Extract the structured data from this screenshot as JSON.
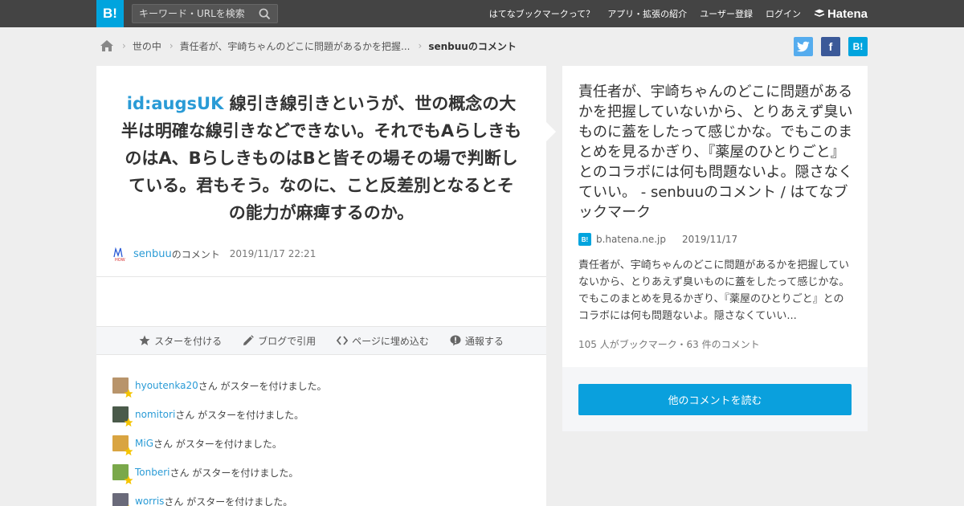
{
  "header": {
    "logo": "B!",
    "search_placeholder": "キーワード・URLを検索",
    "nav": [
      "はてなブックマークって？",
      "アプリ・拡張の紹介",
      "ユーザー登録",
      "ログイン"
    ],
    "brand": "Hatena"
  },
  "breadcrumb": {
    "items": [
      "世の中",
      "責任者が、宇崎ちゃんのどこに問題があるかを把握..."
    ],
    "current": "senbuuのコメント"
  },
  "share": {
    "twitter": "t",
    "facebook": "f",
    "hatena": "B!"
  },
  "comment": {
    "user_id": "id:augsUK",
    "text": " 線引き線引きというが、世の概念の大半は明確な線引きなどできない。それでもAらしきものはA、BらしきものはBと皆その場その場で判断している。君もそう。なのに、こと反差別となるとその能力が麻痺するのか。",
    "author": "senbuu",
    "author_suffix": "のコメント",
    "datetime": "2019/11/17 22:21"
  },
  "actions": [
    "スターを付ける",
    "ブログで引用",
    "ページに埋め込む",
    "通報する"
  ],
  "stars": {
    "suffix": "さん がスターを付けました。",
    "users": [
      {
        "name": "hyoutenka20",
        "color": "#b8946b"
      },
      {
        "name": "nomitori",
        "color": "#4a5a4a"
      },
      {
        "name": "MiG",
        "color": "#d9a441"
      },
      {
        "name": "Tonberi",
        "color": "#7aa84a"
      },
      {
        "name": "worris",
        "color": "#6a6a7a"
      }
    ]
  },
  "entry": {
    "title": "責任者が、宇崎ちゃんのどこに問題があるかを把握していないから、とりあえず臭いものに蓋をしたって感じかな。でもこのまとめを見るかぎり、『薬屋のひとりごと』とのコラボには何も問題ないよ。隠さなくていい。 - senbuuのコメント / はてなブックマーク",
    "favicon": "B!",
    "domain": "b.hatena.ne.jp",
    "date": "2019/11/17",
    "description": "責任者が、宇崎ちゃんのどこに問題があるかを把握していないから、とりあえず臭いものに蓋をしたって感じかな。でもこのまとめを見るかぎり、『薬屋のひとりごと』とのコラボには何も問題ないよ。隠さなくていい...",
    "stats": "105 人がブックマーク・63 件のコメント",
    "read_more": "他のコメントを読む"
  }
}
